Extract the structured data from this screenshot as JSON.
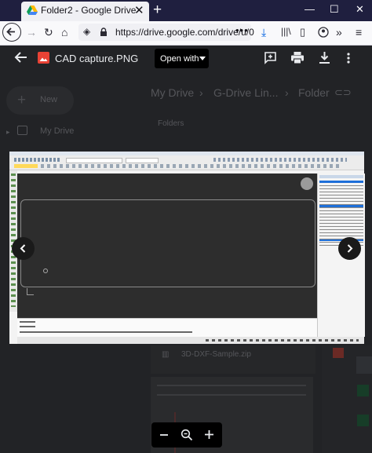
{
  "browser": {
    "tab_title": "Folder2 - Google Drive",
    "url": "https://drive.google.com/drive/u/0",
    "url_overflow": "•••"
  },
  "drive": {
    "new_label": "New",
    "my_drive_label": "My Drive",
    "breadcrumb": [
      "My Drive",
      "G-Drive Lin...",
      "Folder"
    ],
    "section_folders": "Folders",
    "file_name": "3D-DXF-Sample.zip"
  },
  "viewer": {
    "file_name": "CAD capture.PNG",
    "open_with_label": "Open with"
  },
  "colors": {
    "tab_strip": "#1f1f3f",
    "overlay": "#1e1f22",
    "cad_canvas": "#2d2d2d",
    "cad_panel_accent": "#1e6fd9",
    "png_icon": "#e94235"
  }
}
